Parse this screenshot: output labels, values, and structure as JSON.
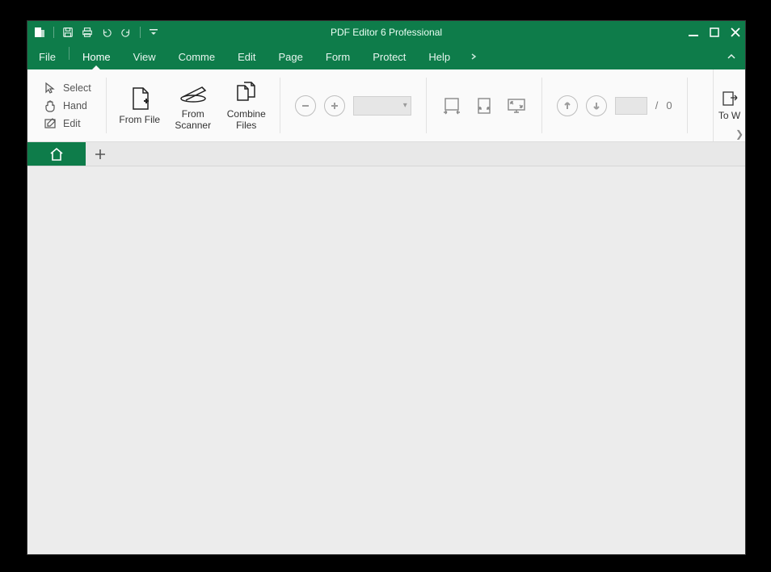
{
  "app": {
    "title": "PDF Editor 6 Professional"
  },
  "menu": {
    "items": [
      "File",
      "Home",
      "View",
      "Comme",
      "Edit",
      "Page",
      "Form",
      "Protect",
      "Help"
    ],
    "active_index": 1
  },
  "ribbon": {
    "tools": {
      "select": "Select",
      "hand": "Hand",
      "edit": "Edit"
    },
    "create": {
      "from_file": "From File",
      "from_scanner": "From\nScanner",
      "combine_files": "Combine\nFiles"
    },
    "page_nav": {
      "total_sep": "/",
      "total": "0"
    },
    "convert": {
      "to_word": "To W"
    }
  },
  "colors": {
    "brand": "#0e7c4a"
  }
}
